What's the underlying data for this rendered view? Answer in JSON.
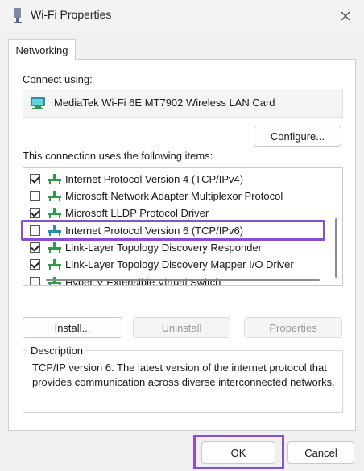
{
  "window": {
    "title": "Wi-Fi Properties",
    "icon": "wifi-adapter-icon",
    "close_icon": "close-icon"
  },
  "tabs": [
    {
      "label": "Networking",
      "active": true
    }
  ],
  "connect_using": {
    "label": "Connect using:",
    "adapter_name": "MediaTek Wi-Fi 6E MT7902 Wireless LAN Card",
    "adapter_icon": "network-adapter-icon"
  },
  "buttons": {
    "configure": "Configure...",
    "install": "Install...",
    "uninstall": "Uninstall",
    "properties": "Properties",
    "ok": "OK",
    "cancel": "Cancel"
  },
  "items_label": "This connection uses the following items:",
  "items": [
    {
      "label": "Internet Protocol Version 4 (TCP/IPv4)",
      "checked": true
    },
    {
      "label": "Microsoft Network Adapter Multiplexor Protocol",
      "checked": false
    },
    {
      "label": "Microsoft LLDP Protocol Driver",
      "checked": true
    },
    {
      "label": "Internet Protocol Version 6 (TCP/IPv6)",
      "checked": false,
      "selected": true
    },
    {
      "label": "Link-Layer Topology Discovery Responder",
      "checked": true
    },
    {
      "label": "Link-Layer Topology Discovery Mapper I/O Driver",
      "checked": true
    },
    {
      "label": "Hyper-V Extensible Virtual Switch",
      "checked": false
    }
  ],
  "description": {
    "legend": "Description",
    "text": "TCP/IP version 6. The latest version of the internet protocol that provides communication across diverse interconnected networks."
  },
  "colors": {
    "highlight": "#8a4fd1",
    "net_icon_green": "#2e9b4a",
    "net_icon_teal": "#2b8fa3"
  }
}
